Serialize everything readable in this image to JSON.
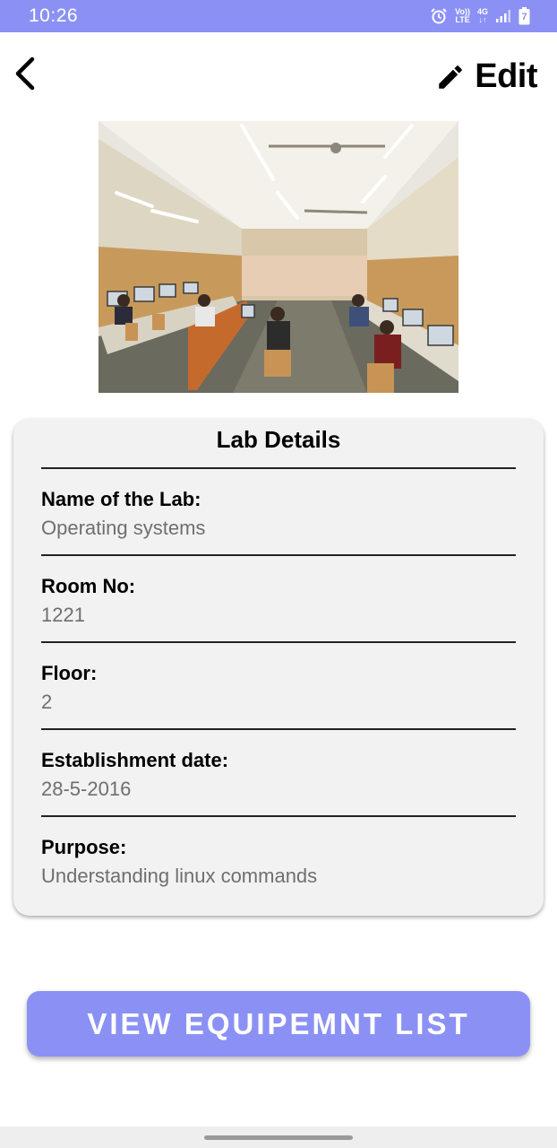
{
  "status_bar": {
    "time": "10:26",
    "volte_top": "Vo))",
    "volte_bottom": "LTE",
    "network": "4G",
    "battery_level": "7",
    "icons": [
      "alarm-icon",
      "signal-icon",
      "battery-icon"
    ]
  },
  "header": {
    "back_icon": "chevron-left-icon",
    "edit_icon": "pencil-icon",
    "edit_label": "Edit"
  },
  "photo": {
    "subject": "computer-lab-photo"
  },
  "card": {
    "title": "Lab Details",
    "fields": [
      {
        "label": "Name of the Lab:",
        "value": "Operating systems"
      },
      {
        "label": "Room No:",
        "value": "1221"
      },
      {
        "label": "Floor:",
        "value": "2"
      },
      {
        "label": "Establishment date:",
        "value": "28-5-2016"
      },
      {
        "label": "Purpose:",
        "value": "Understanding linux commands"
      }
    ]
  },
  "action": {
    "button_label": "VIEW EQUIPEMNT LIST"
  },
  "colors": {
    "accent": "#8b91f4",
    "card_bg": "#f2f2f2",
    "value_text": "#6f6f6f"
  }
}
